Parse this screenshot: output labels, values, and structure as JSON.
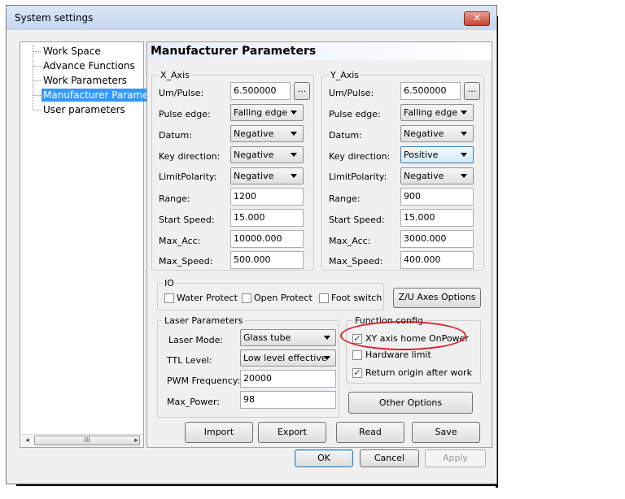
{
  "window": {
    "title": "System settings",
    "close": "✕"
  },
  "tree": {
    "items": [
      "Work Space",
      "Advance Functions",
      "Work Parameters",
      "Manufacturer Paramet",
      "User parameters"
    ],
    "selected_index": 3,
    "scroll_left": "◂",
    "scroll_right": "▸",
    "scroll_grip": "III"
  },
  "panel": {
    "title": "Manufacturer Parameters"
  },
  "x_axis": {
    "legend": "X_Axis",
    "um_pulse_label": "Um/Pulse:",
    "um_pulse": "6.500000",
    "pulse_edge_label": "Pulse edge:",
    "pulse_edge": "Falling edge",
    "datum_label": "Datum:",
    "datum": "Negative",
    "key_direction_label": "Key direction:",
    "key_direction": "Negative",
    "limit_polarity_label": "LimitPolarity:",
    "limit_polarity": "Negative",
    "range_label": "Range:",
    "range": "1200",
    "start_speed_label": "Start Speed:",
    "start_speed": "15.000",
    "max_acc_label": "Max_Acc:",
    "max_acc": "10000.000",
    "max_speed_label": "Max_Speed:",
    "max_speed": "500.000",
    "browse": "..."
  },
  "y_axis": {
    "legend": "Y_Axis",
    "um_pulse_label": "Um/Pulse:",
    "um_pulse": "6.500000",
    "pulse_edge_label": "Pulse edge:",
    "pulse_edge": "Falling edge",
    "datum_label": "Datum:",
    "datum": "Negative",
    "key_direction_label": "Key direction:",
    "key_direction": "Positive",
    "limit_polarity_label": "LimitPolarity:",
    "limit_polarity": "Negative",
    "range_label": "Range:",
    "range": "900",
    "start_speed_label": "Start Speed:",
    "start_speed": "15.000",
    "max_acc_label": "Max_Acc:",
    "max_acc": "3000.000",
    "max_speed_label": "Max_Speed:",
    "max_speed": "400.000",
    "browse": "..."
  },
  "io": {
    "legend": "IO",
    "water_protect": "Water Protect",
    "open_protect": "Open Protect",
    "foot_switch": "Foot switch",
    "zu_button": "Z/U Axes Options"
  },
  "laser": {
    "legend": "Laser Parameters",
    "mode_label": "Laser Mode:",
    "mode": "Glass tube",
    "ttl_label": "TTL Level:",
    "ttl": "Low level effective",
    "pwm_label": "PWM Frequency:",
    "pwm": "20000",
    "max_power_label": "Max_Power:",
    "max_power": "98"
  },
  "function_config": {
    "legend": "Function config",
    "xy_home": "XY axis home OnPower",
    "xy_home_checked": true,
    "hardware_limit": "Hardware limit",
    "hardware_limit_checked": false,
    "return_origin": "Return origin after work",
    "return_origin_checked": true,
    "other_options": "Other Options",
    "check_mark": "✓"
  },
  "actions": {
    "import": "Import",
    "export": "Export",
    "read": "Read",
    "save": "Save"
  },
  "dialog": {
    "ok": "OK",
    "cancel": "Cancel",
    "apply": "Apply"
  },
  "colors": {
    "selection": "#3399ff",
    "annotation_circle": "#d8202a",
    "title_gradient_top": "#dbe7f5"
  }
}
